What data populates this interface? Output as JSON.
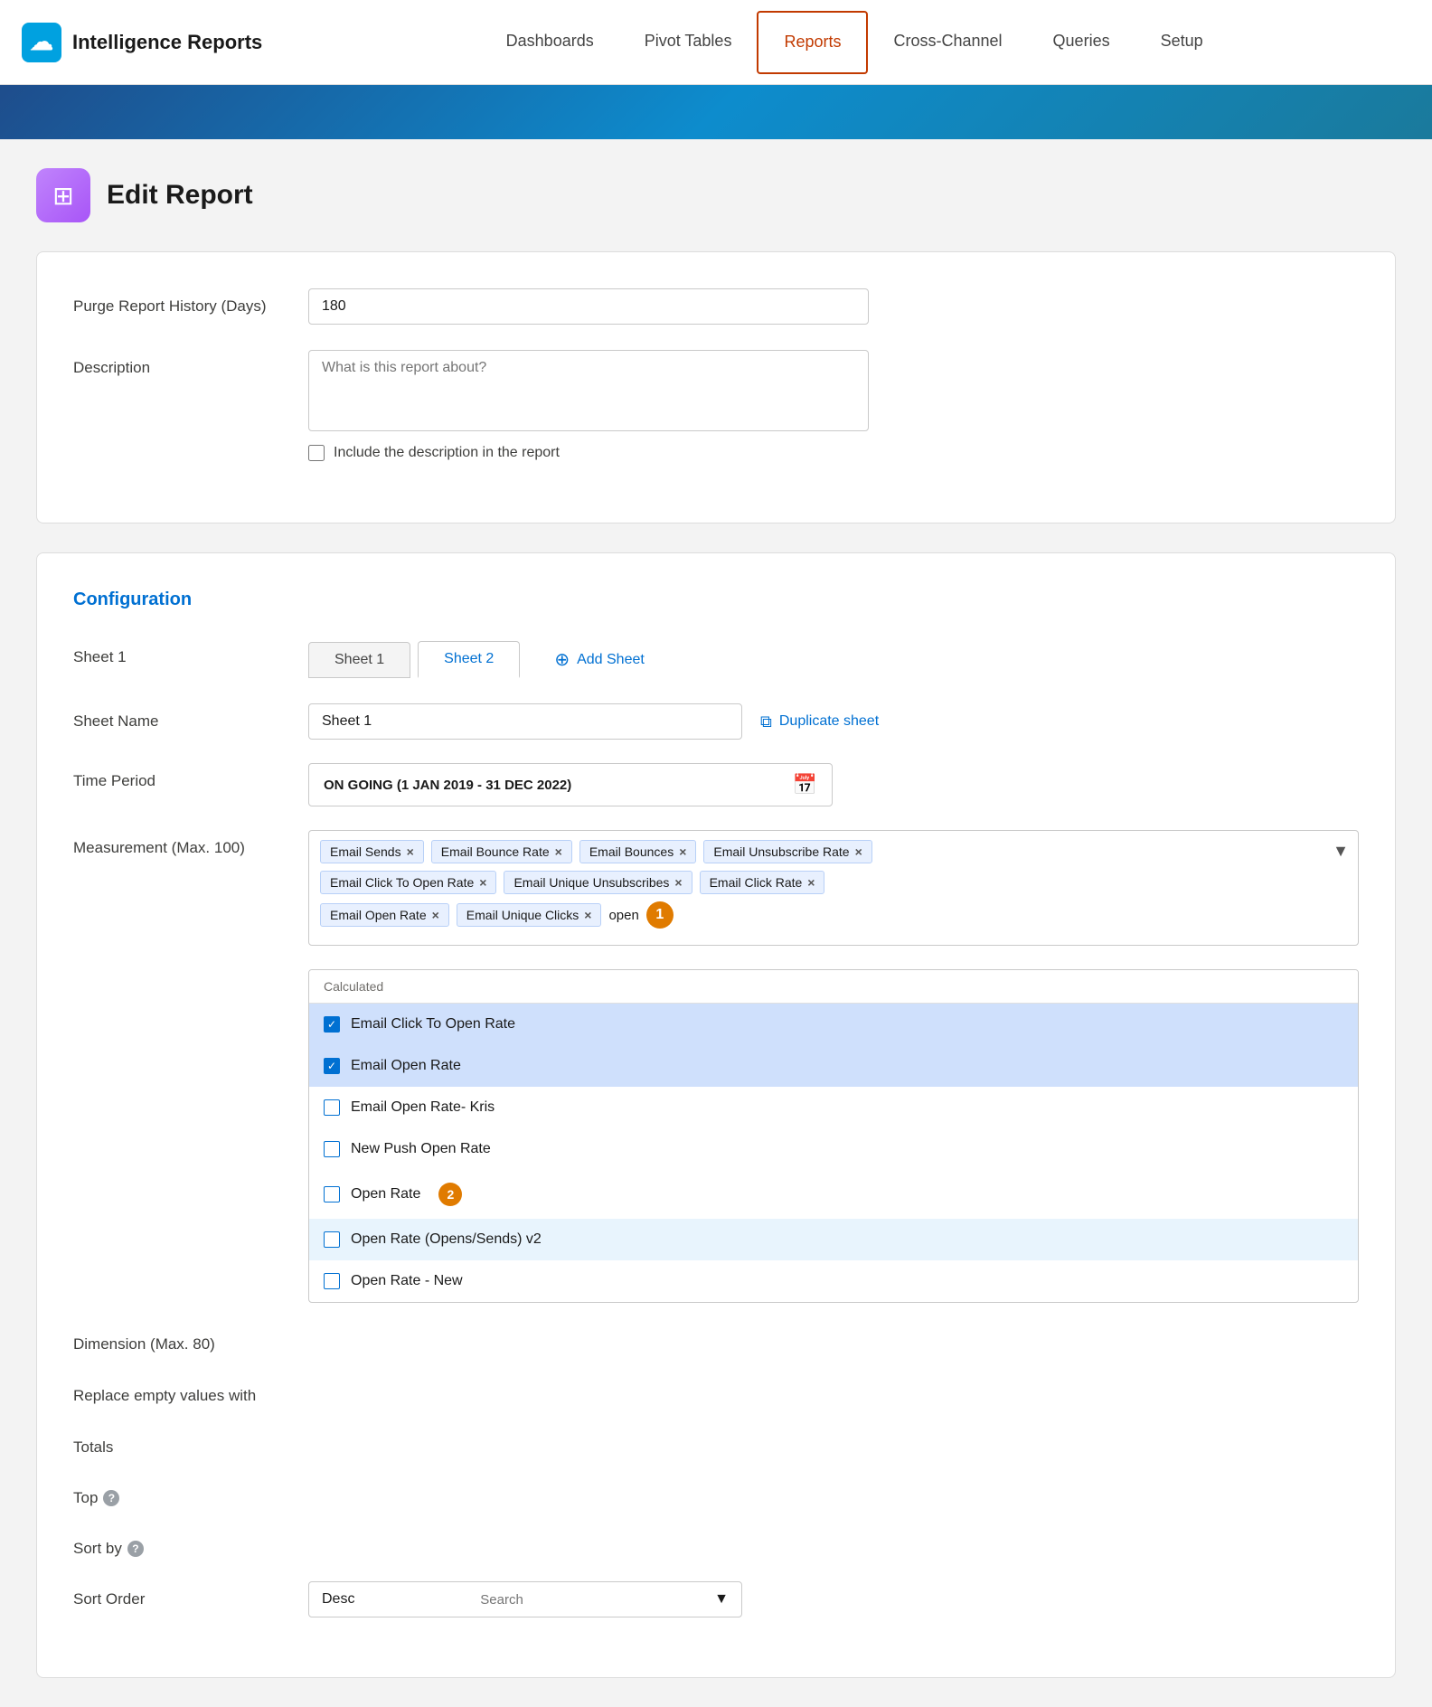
{
  "app": {
    "logo_text": "Intelligence Reports",
    "logo_icon": "☁"
  },
  "nav": {
    "items": [
      {
        "label": "Dashboards",
        "active": false
      },
      {
        "label": "Pivot Tables",
        "active": false
      },
      {
        "label": "Reports",
        "active": true
      },
      {
        "label": "Cross-Channel",
        "active": false
      },
      {
        "label": "Queries",
        "active": false
      },
      {
        "label": "Setup",
        "active": false
      }
    ]
  },
  "page": {
    "title": "Edit Report",
    "icon": "⊞"
  },
  "form": {
    "purge_label": "Purge Report History (Days)",
    "purge_value": "180",
    "description_label": "Description",
    "description_placeholder": "What is this report about?",
    "include_checkbox_label": "Include the description in the report"
  },
  "config": {
    "section_title": "Configuration",
    "sheet_label": "Sheet 1",
    "tab1": "Sheet 1",
    "tab2": "Sheet 2",
    "add_sheet_label": "Add Sheet",
    "sheet_name_label": "Sheet Name",
    "sheet_name_value": "Sheet 1",
    "duplicate_label": "Duplicate sheet",
    "time_period_label": "Time Period",
    "time_period_value": "ON GOING (1 JAN 2019 - 31 DEC 2022)",
    "measurement_label": "Measurement (Max. 100)",
    "dimension_label": "Dimension (Max. 80)",
    "replace_empty_label": "Replace empty values with",
    "totals_label": "Totals",
    "top_label": "Top",
    "sort_by_label": "Sort by",
    "sort_order_label": "Sort Order",
    "sort_order_value": "Desc",
    "sort_order_placeholder": "Search",
    "tags_row1": [
      {
        "label": "Email Sends"
      },
      {
        "label": "Email Bounce Rate"
      },
      {
        "label": "Email Bounces"
      },
      {
        "label": "Email Unsubscribe Rate"
      }
    ],
    "tags_row2": [
      {
        "label": "Email Click To Open Rate"
      },
      {
        "label": "Email Unique Unsubscribes"
      },
      {
        "label": "Email Click Rate"
      }
    ],
    "tags_row3": [
      {
        "label": "Email Open Rate"
      },
      {
        "label": "Email Unique Clicks"
      }
    ],
    "search_text": "open",
    "badge1": "1",
    "badge2": "2",
    "dropdown": {
      "section_label": "Calculated",
      "items": [
        {
          "label": "Email Click To Open Rate",
          "checked": true,
          "highlighted": true
        },
        {
          "label": "Email Open Rate",
          "checked": true,
          "highlighted": true
        },
        {
          "label": "Email Open Rate- Kris",
          "checked": false,
          "highlighted": false
        },
        {
          "label": "New Push Open Rate",
          "checked": false,
          "highlighted": false
        },
        {
          "label": "Open Rate",
          "checked": false,
          "highlighted": false,
          "badge": "2"
        },
        {
          "label": "Open Rate (Opens/Sends) v2",
          "checked": false,
          "highlighted": true
        },
        {
          "label": "Open Rate - New",
          "checked": false,
          "highlighted": false
        }
      ]
    }
  }
}
